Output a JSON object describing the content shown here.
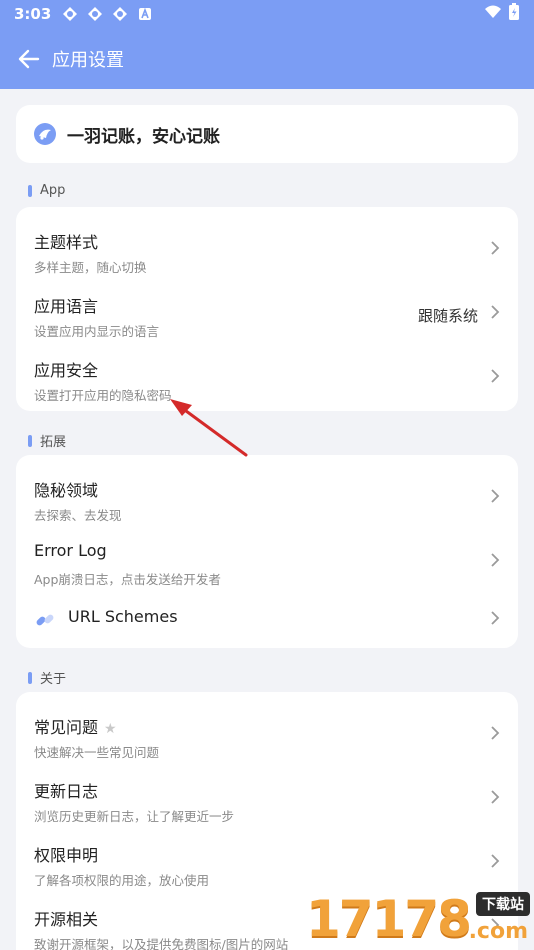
{
  "status": {
    "time": "3:03"
  },
  "appbar": {
    "title": "应用设置"
  },
  "slogan": "一羽记账，安心记账",
  "sections": {
    "app": "App",
    "extend": "拓展",
    "about": "关于"
  },
  "app_items": [
    {
      "title": "主题样式",
      "subtitle": "多样主题，随心切换"
    },
    {
      "title": "应用语言",
      "subtitle": "设置应用内显示的语言",
      "value": "跟随系统"
    },
    {
      "title": "应用安全",
      "subtitle": "设置打开应用的隐私密码"
    }
  ],
  "extend_items": [
    {
      "title": "隐秘领域",
      "subtitle": "去探索、去发现"
    },
    {
      "title": "Error Log",
      "subtitle": "App崩溃日志，点击发送给开发者"
    },
    {
      "title": "URL Schemes"
    }
  ],
  "about_items": [
    {
      "title": "常见问题",
      "subtitle": "快速解决一些常见问题"
    },
    {
      "title": "更新日志",
      "subtitle": "浏览历史更新日志，让了解更近一步"
    },
    {
      "title": "权限申明",
      "subtitle": "了解各项权限的用途，放心使用"
    },
    {
      "title": "开源相关",
      "subtitle": "致谢开源框架，以及提供免费图标/图片的网站"
    }
  ],
  "watermark": {
    "number": "17178",
    "badge": "下载站",
    "suffix": ".com"
  },
  "colors": {
    "primary": "#7b9df4",
    "background": "#f2f3f7",
    "arrow": "#d42a2a"
  }
}
